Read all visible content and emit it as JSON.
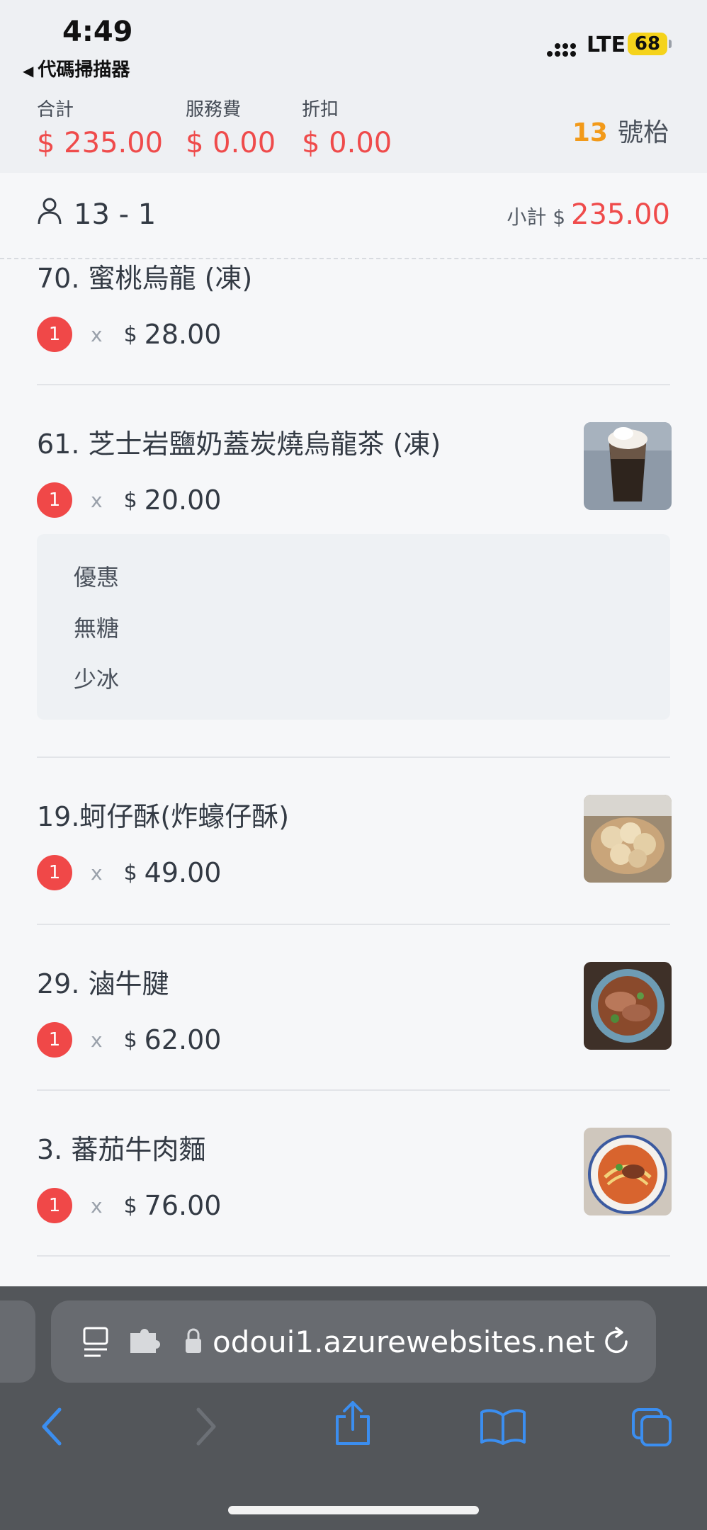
{
  "status": {
    "time": "4:49",
    "back_app": "代碼掃描器",
    "network": "LTE",
    "battery": "68"
  },
  "summary": {
    "total_label": "合計",
    "total_value": "$ 235.00",
    "service_label": "服務費",
    "service_value": "$ 0.00",
    "discount_label": "折扣",
    "discount_value": "$ 0.00",
    "table_number": "13",
    "table_suffix": "號枱"
  },
  "guest": {
    "label": "13 - 1",
    "subtotal_label": "小計 $",
    "subtotal_value": "235.00"
  },
  "items": [
    {
      "name": "70. 蜜桃烏龍 (凍)",
      "qty": "1",
      "times": "x",
      "currency": "$",
      "price": "28.00"
    },
    {
      "name": "61. 芝士岩鹽奶蓋炭燒烏龍茶 (凍)",
      "qty": "1",
      "times": "x",
      "currency": "$",
      "price": "20.00",
      "options": [
        "優惠",
        "無糖",
        "少冰"
      ]
    },
    {
      "name": "19.蚵仔酥(炸蠔仔酥)",
      "qty": "1",
      "times": "x",
      "currency": "$",
      "price": "49.00"
    },
    {
      "name": "29. 滷牛腱",
      "qty": "1",
      "times": "x",
      "currency": "$",
      "price": "62.00"
    },
    {
      "name": "3. 蕃茄牛肉麵",
      "qty": "1",
      "times": "x",
      "currency": "$",
      "price": "76.00"
    }
  ],
  "browser": {
    "url": "odoui1.azurewebsites.net"
  },
  "colors": {
    "accent_red": "#ef4b4b",
    "table_orange": "#f29a1a",
    "safari_blue": "#3b8ef0"
  }
}
